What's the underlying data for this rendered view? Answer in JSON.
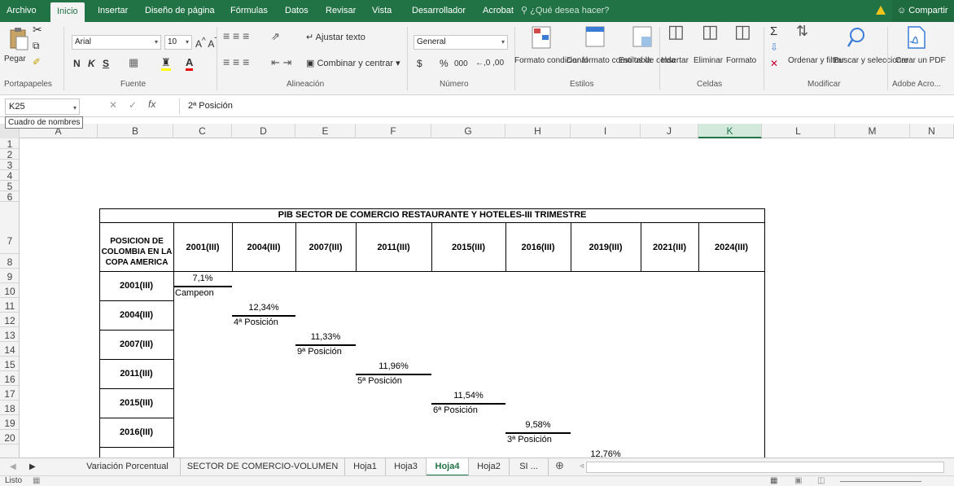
{
  "ribbon_tabs": [
    "Archivo",
    "Inicio",
    "Insertar",
    "Diseño de página",
    "Fórmulas",
    "Datos",
    "Revisar",
    "Vista",
    "Desarrollador",
    "Acrobat"
  ],
  "tell_me": "¿Qué desea hacer?",
  "share": "Compartir",
  "groups": {
    "clipboard": {
      "label": "Portapapeles",
      "paste": "Pegar"
    },
    "font": {
      "label": "Fuente",
      "name": "Arial",
      "size": "10",
      "bold": "N",
      "italic": "K",
      "underline": "S"
    },
    "alignment": {
      "label": "Alineación",
      "wrap": "Ajustar texto",
      "merge": "Combinar y centrar"
    },
    "number": {
      "label": "Número",
      "format": "General",
      "currency": "$",
      "percent": "%",
      "thousands": "000",
      "inc_dec": "←,0 ,00"
    },
    "styles": {
      "label": "Estilos",
      "cond": "Formato condicional",
      "table": "Dar formato como tabla",
      "cell": "Estilos de celda"
    },
    "cells": {
      "label": "Celdas",
      "insert": "Insertar",
      "delete": "Eliminar",
      "format": "Formato"
    },
    "editing": {
      "label": "Modificar",
      "sort": "Ordenar y filtrar",
      "find": "Buscar y seleccionar"
    },
    "acrobat": {
      "label": "Adobe Acro...",
      "create": "Crear un PDF"
    }
  },
  "formula_bar": {
    "name_box": "K25",
    "fx": "fx",
    "value": "2ª Posición",
    "tooltip": "Cuadro de nombres"
  },
  "columns": [
    "A",
    "B",
    "C",
    "D",
    "E",
    "F",
    "G",
    "H",
    "I",
    "J",
    "K",
    "L",
    "M",
    "N"
  ],
  "selected_column": "K",
  "rows": [
    "1",
    "2",
    "3",
    "4",
    "5",
    "6",
    "7",
    "8",
    "9",
    "10",
    "11",
    "12",
    "13",
    "14",
    "15",
    "16",
    "17",
    "18",
    "19",
    "20"
  ],
  "table": {
    "title": "PIB SECTOR DE COMERCIO RESTAURANTE Y HOTELES-III TRIMESTRE",
    "corner": "POSICION DE COLOMBIA EN LA COPA AMERICA",
    "headers": [
      "2001(III)",
      "2004(III)",
      "2007(III)",
      "2011(III)",
      "2015(III)",
      "2016(III)",
      "2019(III)",
      "2021(III)",
      "2024(III)"
    ],
    "row_labels": [
      "2001(III)",
      "2004(III)",
      "2007(III)",
      "2011(III)",
      "2015(III)",
      "2016(III)"
    ],
    "entries": [
      {
        "value": "7,1%",
        "position": "Campeon"
      },
      {
        "value": "12,34%",
        "position": "4ª Posición"
      },
      {
        "value": "11,33%",
        "position": "9ª Posición"
      },
      {
        "value": "11,96%",
        "position": "5ª Posición"
      },
      {
        "value": "11,54%",
        "position": "6ª Posición"
      },
      {
        "value": "9,58%",
        "position": "3ª Posición"
      },
      {
        "value": "12,76%",
        "position": ""
      }
    ]
  },
  "sheet_tabs": [
    "Variación Porcentual",
    "SECTOR DE COMERCIO-VOLUMEN",
    "Hoja1",
    "Hoja3",
    "Hoja4",
    "Hoja2",
    "SI ..."
  ],
  "active_sheet": "Hoja4",
  "status": "Listo"
}
